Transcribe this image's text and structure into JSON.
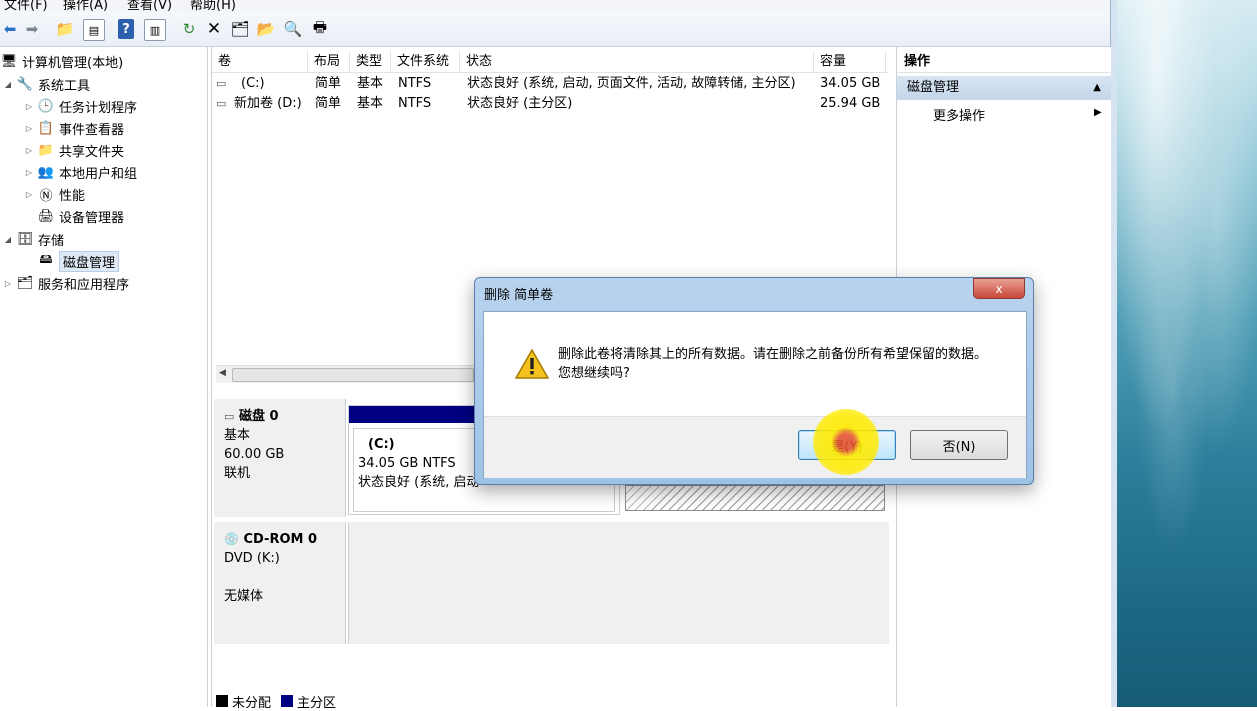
{
  "menu": {
    "items": [
      "文件(F)",
      "操作(A)",
      "查看(V)",
      "帮助(H)"
    ]
  },
  "toolbar": {
    "icons": [
      "back-icon",
      "forward-icon",
      "up-folder-icon",
      "show-hide-tree-icon",
      "help-icon",
      "show-hide-action-icon",
      "refresh-icon",
      "delete-icon",
      "properties-icon",
      "open-icon",
      "search-icon",
      "export-icon"
    ]
  },
  "tree": {
    "root": "计算机管理(本地)",
    "system_tools": "系统工具",
    "task_scheduler": "任务计划程序",
    "event_viewer": "事件查看器",
    "shared_folders": "共享文件夹",
    "local_users": "本地用户和组",
    "performance": "性能",
    "device_manager": "设备管理器",
    "storage": "存储",
    "disk_management": "磁盘管理",
    "services_apps": "服务和应用程序"
  },
  "volumes": {
    "headers": [
      "卷",
      "布局",
      "类型",
      "文件系统",
      "状态",
      "容量"
    ],
    "rows": [
      {
        "name": "(C:)",
        "layout": "简单",
        "type": "基本",
        "fs": "NTFS",
        "status": "状态良好 (系统, 启动, 页面文件, 活动, 故障转储, 主分区)",
        "capacity": "34.05 GB"
      },
      {
        "name": "新加卷 (D:)",
        "layout": "简单",
        "type": "基本",
        "fs": "NTFS",
        "status": "状态良好 (主分区)",
        "capacity": "25.94 GB"
      }
    ]
  },
  "disk0": {
    "name": "磁盘 0",
    "type": "基本",
    "size": "60.00 GB",
    "state": "联机",
    "partition": {
      "label": "(C:)",
      "size_fs": "34.05 GB NTFS",
      "status": "状态良好 (系统, 启动"
    }
  },
  "cdrom0": {
    "name": "CD-ROM 0",
    "drive": "DVD (K:)",
    "media": "无媒体"
  },
  "legend": {
    "unallocated": "未分配",
    "primary": "主分区",
    "unallocated_color": "#000000",
    "primary_color": "#000080"
  },
  "actions": {
    "title": "操作",
    "group": "磁盘管理",
    "more": "更多操作"
  },
  "dialog": {
    "title": "删除 简单卷",
    "close": "x",
    "message": "删除此卷将清除其上的所有数据。请在删除之前备份所有希望保留的数据。您想继续吗?",
    "yes": "是(Y)",
    "no": "否(N)"
  }
}
